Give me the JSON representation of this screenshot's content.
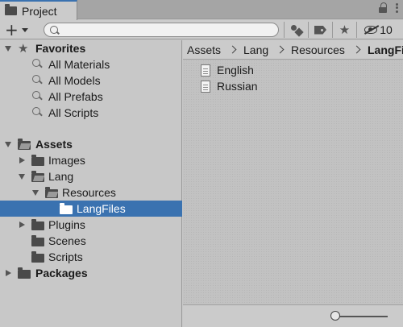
{
  "window": {
    "tab_title": "Project",
    "tab_icon": "folder-icon",
    "accent": "#3a72b0"
  },
  "toolbar": {
    "add_label": "+",
    "search_value": "",
    "search_placeholder": "",
    "hidden_count": "10"
  },
  "tree": {
    "favorites": {
      "label": "Favorites",
      "items": [
        "All Materials",
        "All Models",
        "All Prefabs",
        "All Scripts"
      ]
    },
    "assets": {
      "label": "Assets",
      "images": "Images",
      "lang": "Lang",
      "resources": "Resources",
      "langfiles": "LangFiles",
      "plugins": "Plugins",
      "scenes": "Scenes",
      "scripts": "Scripts"
    },
    "packages": "Packages"
  },
  "breadcrumb": [
    "Assets",
    "Lang",
    "Resources",
    "LangFiles"
  ],
  "files": [
    "English",
    "Russian"
  ],
  "zoom_slider": {
    "value": 0
  }
}
